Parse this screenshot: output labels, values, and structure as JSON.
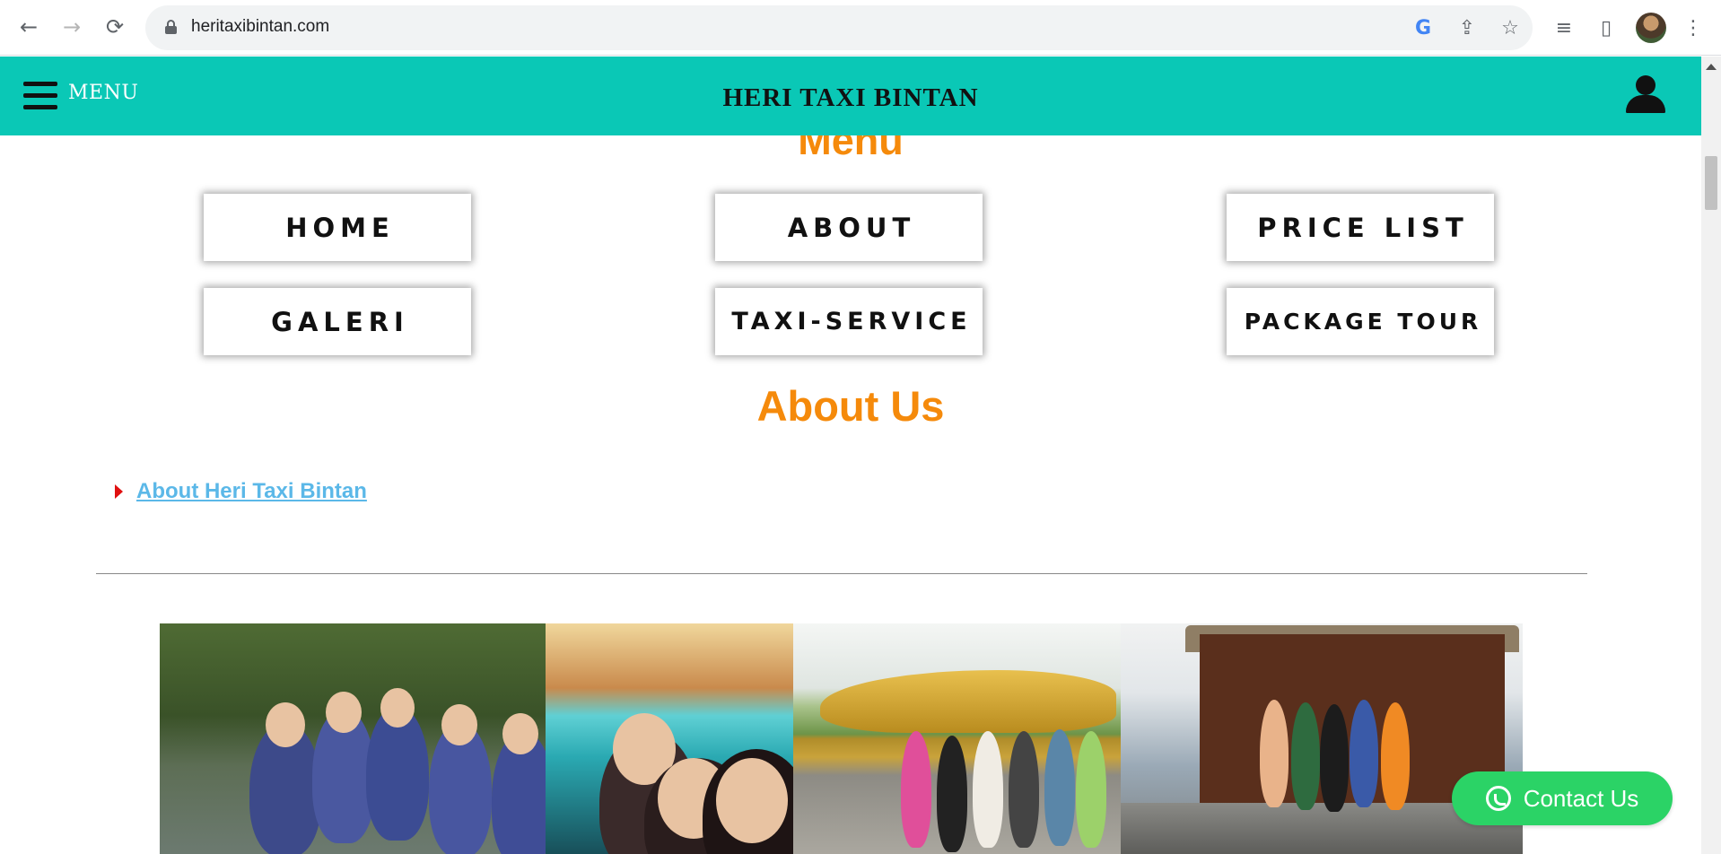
{
  "browser": {
    "url": "heritaxibintan.com",
    "back_icon": "arrow-left-icon",
    "forward_icon": "arrow-right-icon",
    "reload_icon": "reload-icon",
    "toolbar_icons": [
      "google-lens-icon",
      "share-icon",
      "bookmark-star-icon",
      "media-queue-icon",
      "side-panel-icon",
      "profile-avatar",
      "kebab-menu-icon"
    ],
    "glyphs": {
      "back": "←",
      "forward": "→",
      "reload": "⟳",
      "google": "G",
      "share": "⇪",
      "star": "☆",
      "queue": "≡",
      "panel": "▯",
      "kebab": "⋮"
    }
  },
  "site_header": {
    "menu_label": "MENU",
    "title": "HERI TAXI BINTAN",
    "background_color": "#0ac8b6"
  },
  "menu_section": {
    "heading": "Menu",
    "buttons": [
      {
        "label": "HOME"
      },
      {
        "label": "ABOUT"
      },
      {
        "label": "PRICE LIST"
      },
      {
        "label": "GALERI"
      },
      {
        "label": "TAXI-SERVICE"
      },
      {
        "label": "PACKAGE TOUR"
      }
    ]
  },
  "about_section": {
    "heading": "About Us",
    "link_text": "About Heri Taxi Bintan"
  },
  "photos": [
    {
      "name": "boat-tour-photo"
    },
    {
      "name": "lake-selfie-photo"
    },
    {
      "name": "golden-buddha-photo"
    },
    {
      "name": "pier-hut-photo"
    }
  ],
  "contact": {
    "label": "Contact Us",
    "color": "#2bd366"
  },
  "colors": {
    "heading_orange": "#f58a0b",
    "link_blue": "#5bb8e8",
    "bullet_red": "#e01010"
  }
}
